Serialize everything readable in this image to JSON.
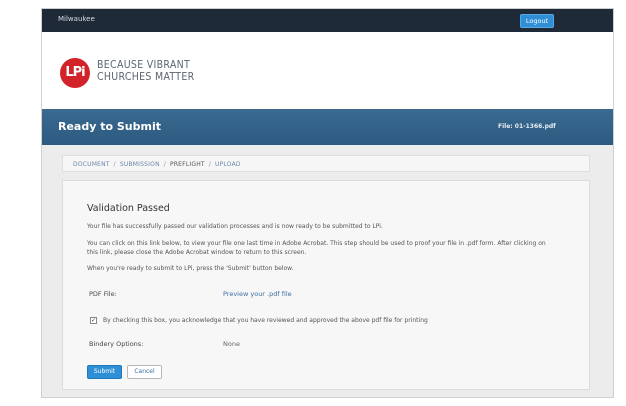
{
  "topbar": {
    "user": "Milwaukee",
    "logout_label": "Logout"
  },
  "brand": {
    "logo_text": "LPi",
    "tagline_line1": "BECAUSE VIBRANT",
    "tagline_line2": "CHURCHES MATTER"
  },
  "titlebar": {
    "title": "Ready to Submit",
    "file": "File: 01-1366.pdf"
  },
  "breadcrumb": {
    "items": [
      "DOCUMENT",
      "SUBMISSION",
      "PREFLIGHT",
      "UPLOAD"
    ],
    "separator": "/"
  },
  "panel": {
    "heading": "Validation Passed",
    "p1": "Your file has successfully passed our validation processes and is now ready to be submitted to LPi.",
    "p2": "You can click on this link below, to view your file one last time in Adobe Acrobat. This step should be used to proof your file in .pdf form. After clicking on this link, please close the Adobe Acrobat window to return to this screen.",
    "p3": "When you're ready to submit to LPi, press the 'Submit' button below.",
    "pdf_label": "PDF File:",
    "pdf_link": "Preview your .pdf file",
    "checkbox_label": "By checking this box, you acknowledge that you have reviewed and approved the above pdf file for printing",
    "checkbox_checked": true,
    "bindery_label": "Bindery Options:",
    "bindery_value": "None",
    "submit_label": "Submit",
    "cancel_label": "Cancel"
  },
  "colors": {
    "topbar": "#1f2a38",
    "titlebar": "#2f5e84",
    "accent": "#2f8fd6",
    "logo_red": "#d3232a"
  }
}
